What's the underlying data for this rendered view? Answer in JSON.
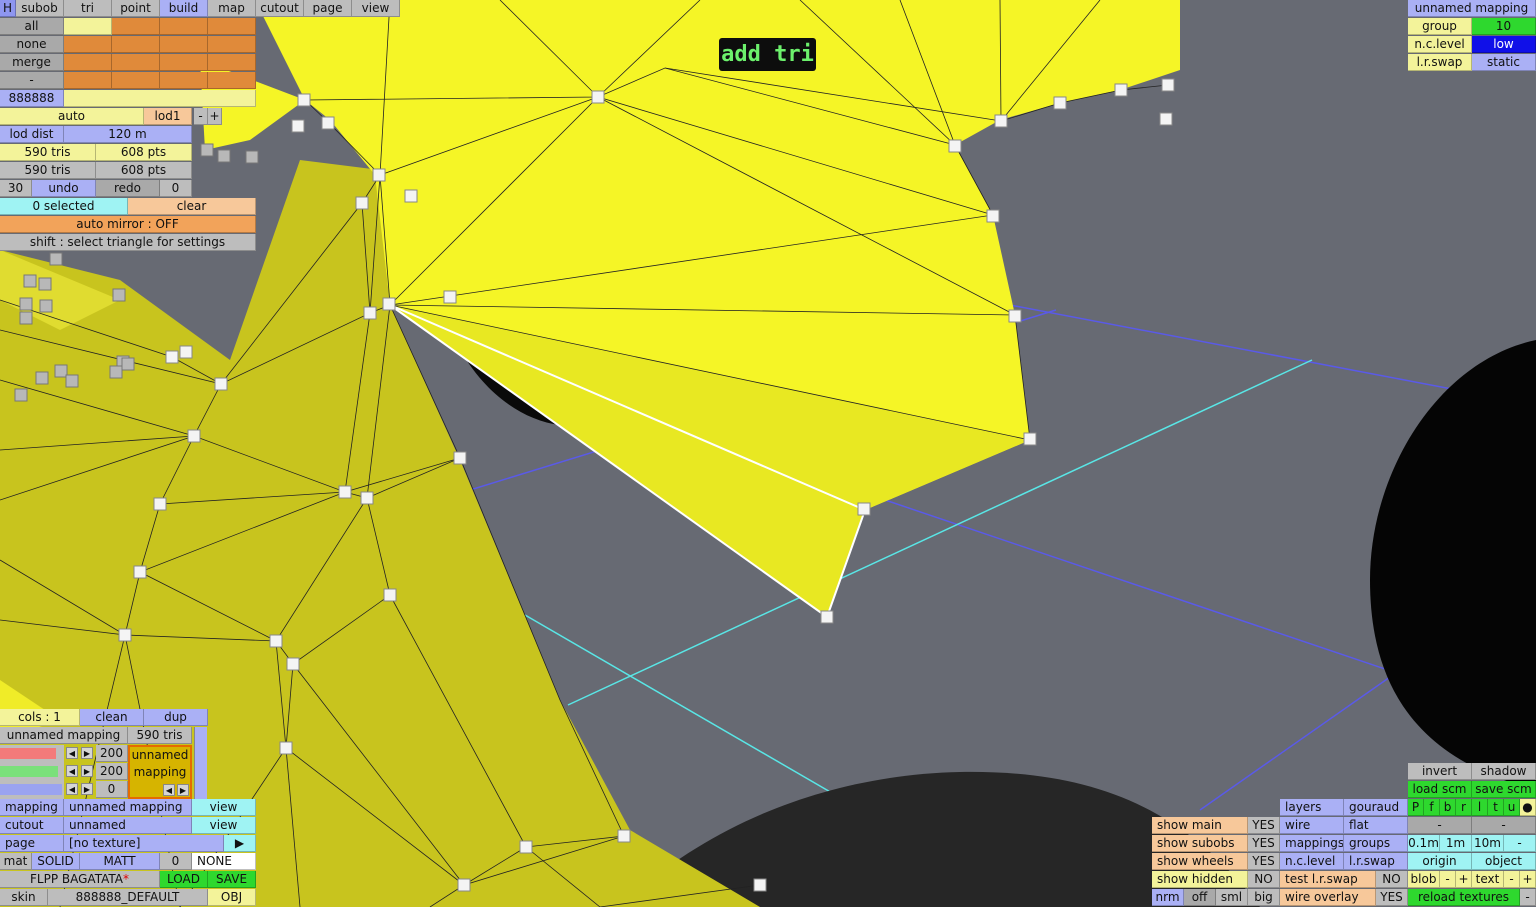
{
  "tooltip": "add tri",
  "top_tabs": [
    {
      "label": "H"
    },
    {
      "label": "subob"
    },
    {
      "label": "tri"
    },
    {
      "label": "point"
    },
    {
      "label": "build"
    },
    {
      "label": "map"
    },
    {
      "label": "cutout"
    },
    {
      "label": "page"
    },
    {
      "label": "view"
    }
  ],
  "left_panel": {
    "all": "all",
    "none": "none",
    "merge": "merge",
    "dash": "-",
    "color_code": "888888",
    "auto": "auto",
    "lod": "lod1",
    "minus": "-",
    "plus": "+",
    "lod_dist_label": "lod dist",
    "lod_dist_value": "120 m",
    "tris1": "590 tris",
    "pts1": "608 pts",
    "tris2": "590 tris",
    "pts2": "608 pts",
    "undo_count": "30",
    "undo": "undo",
    "redo": "redo",
    "redo_count": "0",
    "selected": "0 selected",
    "clear": "clear",
    "auto_mirror": "auto mirror : OFF",
    "hint": "shift : select triangle for settings"
  },
  "top_right": {
    "mapping_name": "unnamed mapping",
    "group_label": "group",
    "group_value": "10",
    "nc_label": "n.c.level",
    "nc_value": "low",
    "lr_label": "l.r.swap",
    "lr_value": "static"
  },
  "bottom_left": {
    "cols": "cols : 1",
    "clean": "clean",
    "dup": "dup",
    "mapping_name": "unnamed mapping",
    "tris": "590 tris",
    "val1": "200",
    "val2": "200",
    "val3": "0",
    "preview_line1": "unnamed",
    "preview_line2": "mapping",
    "mapping_label": "mapping",
    "mapping_value": "unnamed mapping",
    "view1": "view",
    "cutout_label": "cutout",
    "cutout_value": "unnamed",
    "view2": "view",
    "page_label": "page",
    "page_value": "[no texture]",
    "page_arrow": "▶",
    "mat_label": "mat",
    "mat_solid": "SOLID",
    "mat_matt": "MATT",
    "mat_num": "0",
    "mat_none": "NONE",
    "file_name": "FLPP BAGATATA",
    "file_star": "*",
    "load": "LOAD",
    "save": "SAVE",
    "skin_label": "skin",
    "skin_value": "888888_DEFAULT",
    "obj": "OBJ"
  },
  "bottom_right": {
    "show_main": "show main",
    "show_main_v": "YES",
    "show_subobs": "show subobs",
    "show_subobs_v": "YES",
    "show_wheels": "show wheels",
    "show_wheels_v": "YES",
    "show_hidden": "show hidden",
    "show_hidden_v": "NO",
    "nrm": "nrm",
    "off": "off",
    "sml": "sml",
    "big": "big",
    "layers": "layers",
    "gouraud": "gouraud",
    "wire": "wire",
    "flat": "flat",
    "mappings": "mappings",
    "groups": "groups",
    "nclevel": "n.c.level",
    "lrswap": "l.r.swap",
    "test_lr": "test l.r.swap",
    "test_lr_v": "NO",
    "wire_overlay": "wire overlay",
    "wire_overlay_v": "YES",
    "invert": "invert",
    "shadow": "shadow",
    "load_scm": "load scm",
    "save_scm": "save scm",
    "flags": [
      "P",
      "f",
      "b",
      "r",
      "l",
      "t",
      "u",
      "●"
    ],
    "dash1": "-",
    "dash2": "-",
    "d01": "0.1m",
    "d1": "1m",
    "d10": "10m",
    "dminus": "-",
    "origin": "origin",
    "object": "object",
    "blob": "blob",
    "blob_m": "-",
    "blob_p": "+",
    "text": "text",
    "text_m": "-",
    "text_p": "+",
    "reload": "reload textures",
    "reload_m": "-"
  },
  "colors": {
    "viewport_bg": "#676a73",
    "mesh_yellow": "#f5f526",
    "mesh_olive": "#c8c41e",
    "ui_lavender": "#aab0f5",
    "ui_orange": "#e08a3a",
    "ui_yellow": "#f3f39a",
    "accent_green": "#2ed82e"
  }
}
